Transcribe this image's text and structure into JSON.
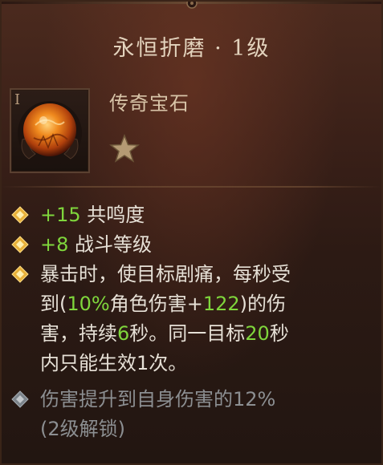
{
  "item": {
    "name": "永恒折磨 · 1级",
    "type": "传奇宝石",
    "rank_glyph": "I",
    "rank_stars": 1,
    "gem_icon": "orange-gem-icon"
  },
  "affixes": [
    {
      "bonus_value": "+15",
      "bonus_label": " 共鸣度"
    },
    {
      "bonus_value": "+8",
      "bonus_label": " 战斗等级"
    },
    {
      "line1": "暴击时，使目标剧痛，每秒受",
      "line2_pre": "到(",
      "line2_pct": "10%",
      "line2_mid": "角色伤害+",
      "line2_flat": "122",
      "line2_post": ")的伤",
      "line3_pre": "害，持续",
      "line3_sec": "6",
      "line3_mid": "秒。同一目标",
      "line3_cd": "20",
      "line3_post": "秒",
      "line4": "内只能生效1次。"
    },
    {
      "line1": "伤害提升到自身伤害的12%",
      "line2": "(2级解锁)"
    }
  ],
  "colors": {
    "title": "#e3d3bd",
    "bonus_value": "#7fd63c",
    "text": "#e6e0d6",
    "locked_text": "#8c8f92",
    "diamond_active": "#e8b13a",
    "diamond_locked": "#8a9299"
  }
}
